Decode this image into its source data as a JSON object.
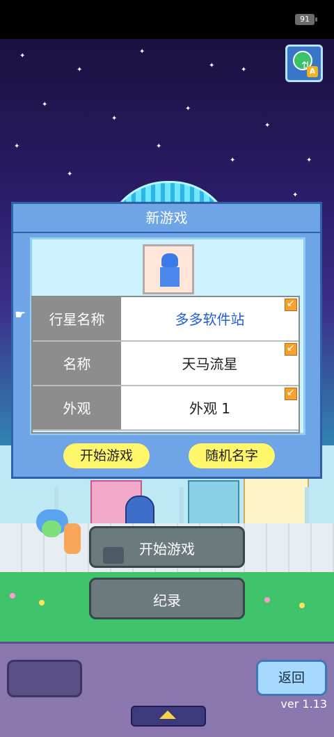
{
  "status_bar": {
    "battery": "91"
  },
  "language_button": {
    "icon": "globe-swap-icon",
    "badge": "A"
  },
  "dialog": {
    "title": "新游戏",
    "rows": [
      {
        "label": "行星名称",
        "value": "多多软件站"
      },
      {
        "label": "名称",
        "value": "天马流星"
      },
      {
        "label": "外观",
        "value": "外观 1"
      }
    ],
    "start_label": "开始游戏",
    "random_label": "随机名字"
  },
  "menu": {
    "start_label": "开始游戏",
    "records_label": "纪录"
  },
  "bottom": {
    "back_label": "返回",
    "version": "ver 1.13"
  },
  "colors": {
    "dialog_frame": "#6fa4e6",
    "pill": "#fff66a",
    "planet_name": "#1f5ed8",
    "menu_button": "#6b7a7d",
    "back_button": "#a6d9ff"
  }
}
